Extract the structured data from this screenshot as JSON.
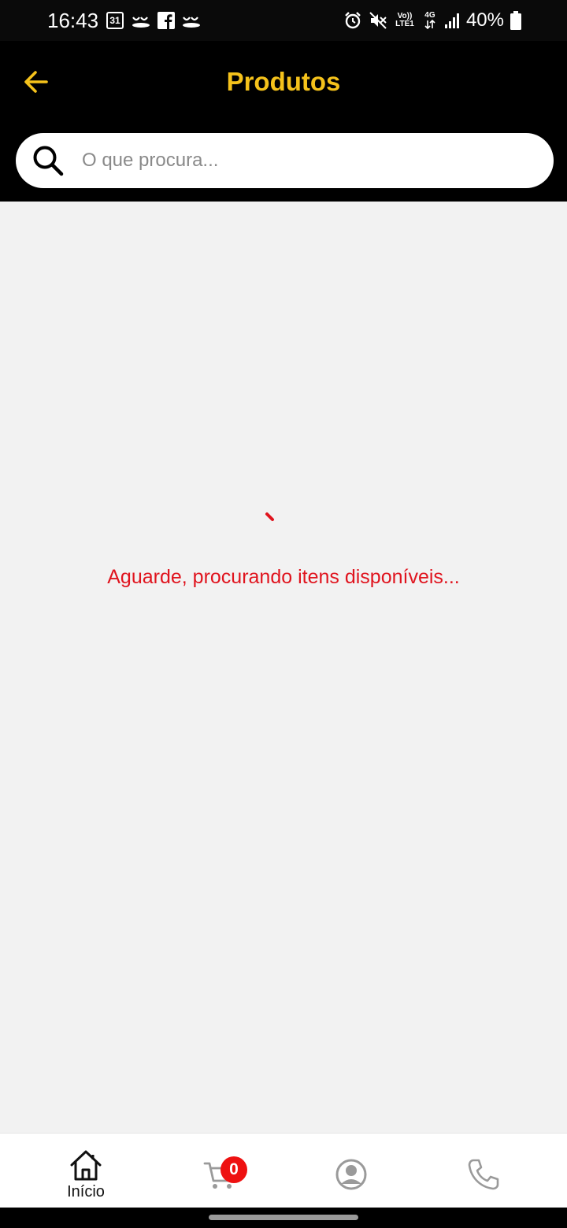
{
  "status_bar": {
    "time": "16:43",
    "calendar_day": "31",
    "network_top": "Vo))",
    "network_bottom": "LTE1",
    "network_type": "4G",
    "battery": "40%",
    "left_icons": [
      "calendar-icon",
      "notification-app-icon",
      "facebook-icon",
      "notification-app-icon"
    ],
    "right_icons": [
      "alarm-icon",
      "mute-icon",
      "volte-icon",
      "4g-data-icon",
      "signal-icon",
      "battery-icon"
    ]
  },
  "header": {
    "title": "Produtos",
    "back_icon": "arrow-left-icon",
    "accent_color": "#f5c21b",
    "background_color": "#000000"
  },
  "search": {
    "placeholder": "O que procura...",
    "value": "",
    "icon": "search-icon"
  },
  "content": {
    "loading_message": "Aguarde, procurando itens disponíveis...",
    "loading_color": "#e0141e"
  },
  "bottom_nav": {
    "items": [
      {
        "id": "home",
        "label": "Início",
        "icon": "home-icon",
        "active": true
      },
      {
        "id": "cart",
        "label": "",
        "icon": "cart-icon",
        "badge": "0",
        "active": false
      },
      {
        "id": "profile",
        "label": "",
        "icon": "user-circle-icon",
        "active": false
      },
      {
        "id": "phone",
        "label": "",
        "icon": "phone-icon",
        "active": false
      }
    ],
    "badge_color": "#ee1111"
  }
}
